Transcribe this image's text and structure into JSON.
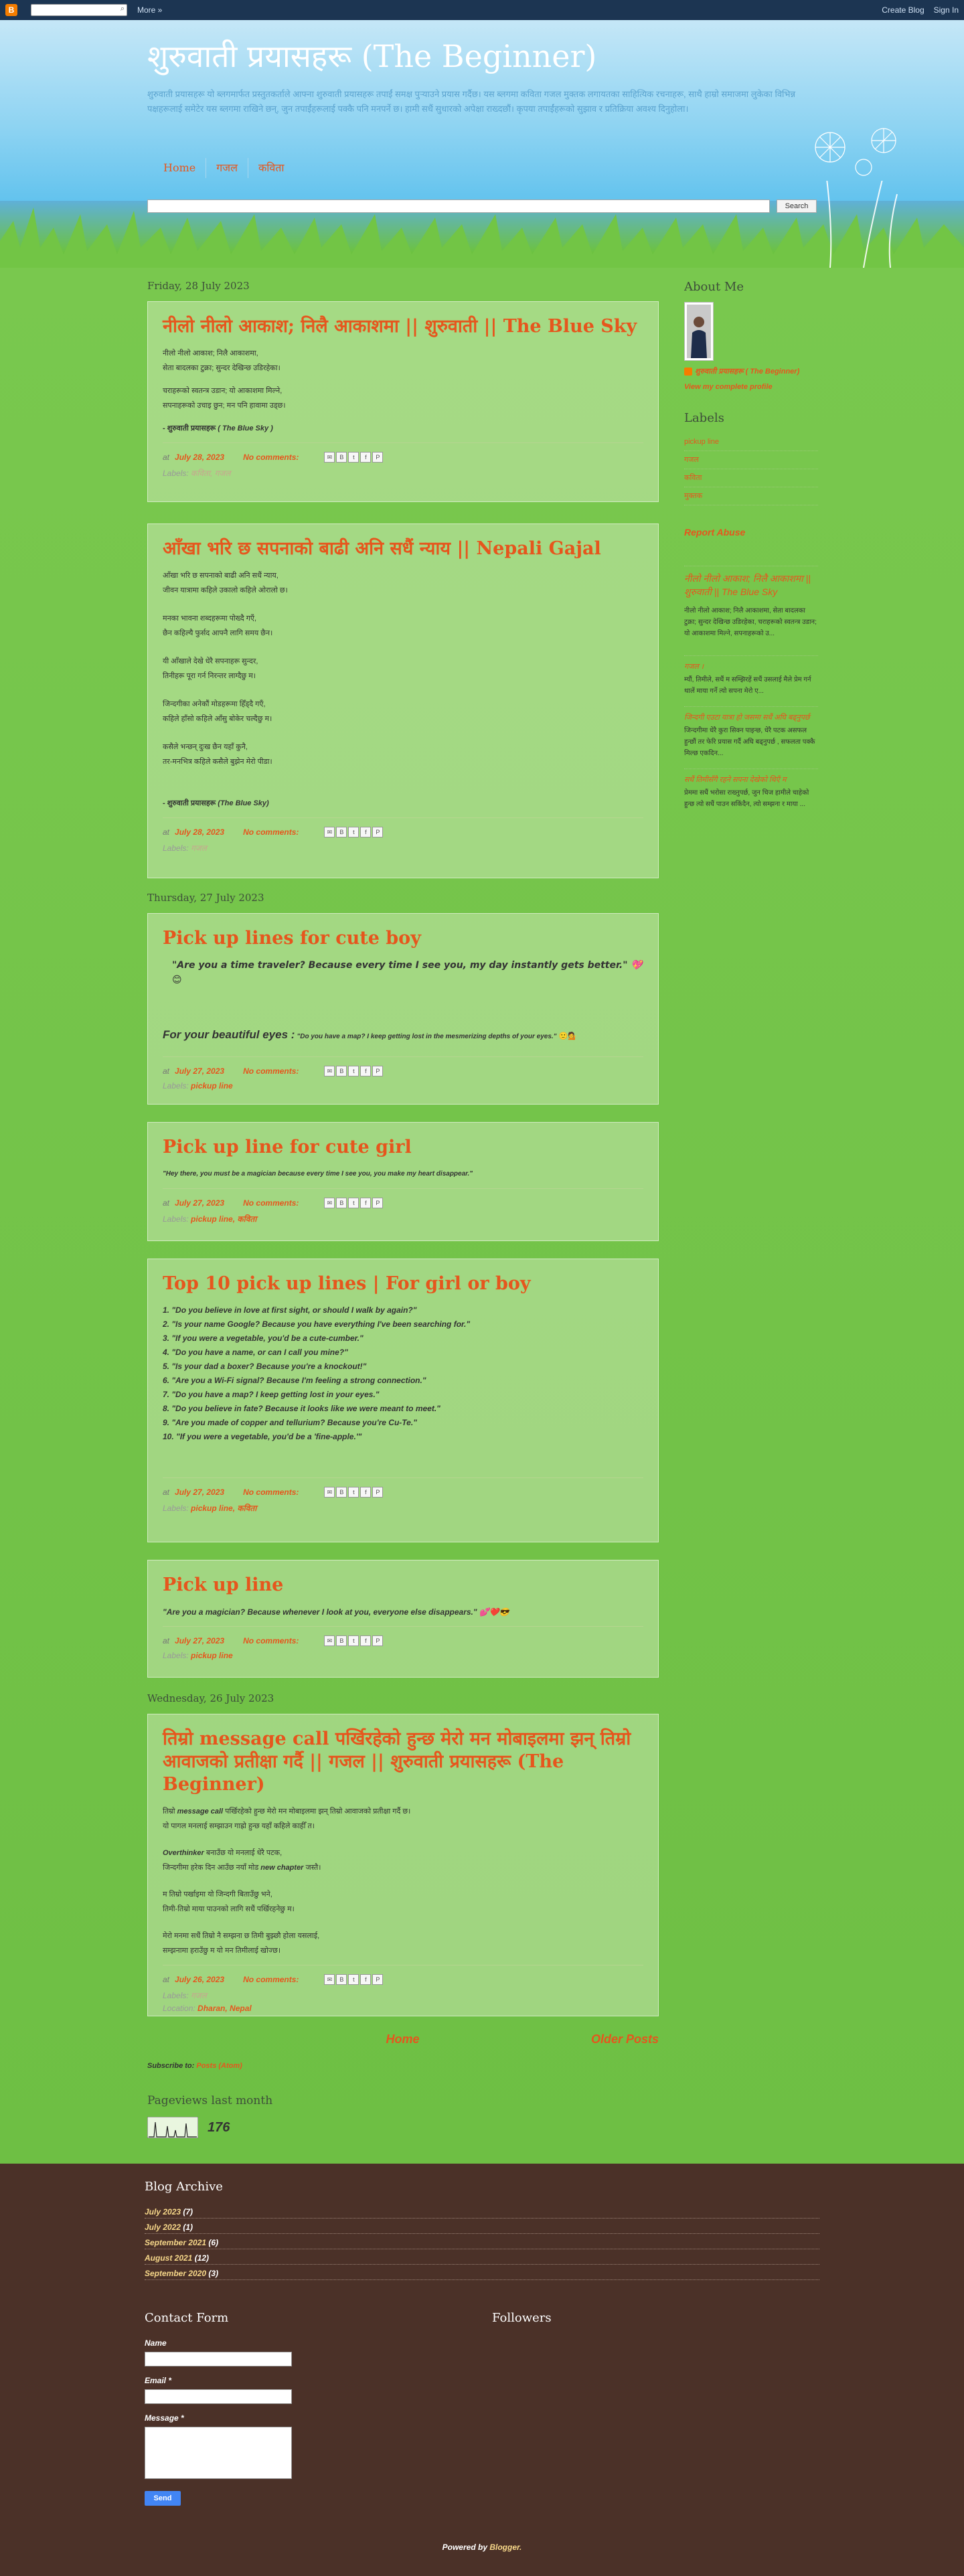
{
  "navbar": {
    "search_icon": "search-icon",
    "more": "More »",
    "create": "Create Blog",
    "signin": "Sign In"
  },
  "header": {
    "title": "शुरुवाती प्रयासहरू (The Beginner)",
    "description": "शुरुवाती प्रयासहरू यो ब्लगमार्फत प्रस्तुतकर्ताले आफ्ना शुरुवाती प्रयासहरू तपाईं समक्ष पुर्‍याउने प्रयास गर्दैछ। यस ब्लगमा कविता गजल मुक्तक लगायतका साहित्यिक रचनाहरू, साथै हाम्रो समाजमा लुकेका विभिन्न पक्षहरूलाई समेटेर यस ब्लगमा राखिने छन्, जुन तपाईंहरूलाई पक्कै पनि मनपर्ने छ। हामी सधैं सुधारको अपेक्षा राख्दछौं। कृपया तपाईंहरूको सुझाव र प्रतिक्रिया अवश्य दिनुहोला।"
  },
  "tabs": [
    "Home",
    "गजल",
    "कविता"
  ],
  "search": {
    "button": "Search"
  },
  "dates": [
    "Friday, 28 July 2023",
    "Thursday, 27 July 2023",
    "Wednesday, 26 July 2023"
  ],
  "posts": [
    {
      "title": "नीलो नीलो आकाश; निलै आकाशमा || शुरुवाती || The Blue Sky",
      "lines": [
        "नीलो नीलो आकाश; निलै आकाशमा,",
        "सेता बादलका टुक्रा; सुन्दर देखिन्छ उडिरहेका।",
        "चराहरूको स्वतन्त्र उडान; यो आकाशमा मिल्ने,",
        "सपनाहरूको उचाइ छुन; मन पनि हावामा उड्छ।"
      ],
      "author": "- शुरुवाती प्रयासहरू",
      "author_em": "( The Blue Sky )",
      "date": "July 28, 2023",
      "comments": "No comments:",
      "labels_prefix": "Labels:",
      "labels": "कविता, गजल"
    },
    {
      "title": "आँखा भरि छ सपनाको बाढी अनि सधैं न्याय || Nepali Gajal",
      "lines": [
        "आँखा भरि छ सपनाको बाढी अनि सधैं न्याय,",
        "जीवन यात्रामा कहिले उकालो कहिले ओरालो छ।",
        "मनका भावना शब्दहरूमा पोख्दै गएँ,",
        "छैन कहिल्यै फुर्सद आफ्नै लागि समय छैन।",
        "यी आँखाले देखे धेरै सपनाहरू सुन्दर,",
        "तिनीहरू पूरा गर्न निरन्तर लाग्दैछु म।",
        "जिन्दगीका अनेकौं मोडहरूमा हिँड्दै गएँ,",
        "कहिले हाँसो कहिले आँसु बोकेर चल्दैछु म।",
        "कसैले भन्छन् दुःख छैन यहाँ कुनै,",
        "तर-मनभित्र कहिले कसैले बुझेन मेरो पीडा।"
      ],
      "author": "- शुरुवाती प्रयासहरू",
      "author_em": "(The Blue Sky)",
      "date": "July 28, 2023",
      "comments": "No comments:",
      "labels_prefix": "Labels:",
      "labels": "गजल"
    },
    {
      "title": "Pick up lines for cute boy",
      "line1": "\"Are you a time traveler? Because every time I see you, my day instantly gets better.\"",
      "emoji1": "💖😊",
      "line2_head": "For your beautiful eyes :",
      "line2": "\"Do you have a map? I keep getting lost in the mesmerizing depths of your eyes.\"",
      "emoji2": "🙂💁",
      "date": "July 27, 2023",
      "comments": "No comments:",
      "labels_prefix": "Labels:",
      "labels": "pickup line"
    },
    {
      "title": "Pick up line for cute girl",
      "line1": "\"Hey there, you must be a magician because every time I see you, you make my heart disappear.\"",
      "date": "July 27, 2023",
      "comments": "No comments:",
      "labels_prefix": "Labels:",
      "labels": "pickup line, कविता"
    },
    {
      "title": "Top 10 pick up lines | For girl or boy",
      "items": [
        "1. \"Do you believe in love at first sight, or should I walk by again?\"",
        "2. \"Is your name Google? Because you have everything I've been searching for.\"",
        "3. \"If you were a vegetable, you'd be a cute-cumber.\"",
        "4. \"Do you have a name, or can I call you mine?\"",
        "5. \"Is your dad a boxer? Because you're a knockout!\"",
        "6. \"Are you a Wi-Fi signal? Because I'm feeling a strong connection.\"",
        "7. \"Do you have a map? I keep getting lost in your eyes.\"",
        "8. \"Do you believe in fate? Because it looks like we were meant to meet.\"",
        "9. \"Are you made of copper and tellurium? Because you're Cu-Te.\"",
        "10. \"If you were a vegetable, you'd be a 'fine-apple.'\""
      ],
      "date": "July 27, 2023",
      "comments": "No comments:",
      "labels_prefix": "Labels:",
      "labels": "pickup line, कविता"
    },
    {
      "title": "Pick up line",
      "line1": "\"Are you a magician? Because whenever I look at you, everyone else disappears.\"",
      "emoji1": "💕❤️😎",
      "date": "July 27, 2023",
      "comments": "No comments:",
      "labels_prefix": "Labels:",
      "labels": "pickup line"
    },
    {
      "title": "तिम्रो message call पर्खिरहेको हुन्छ मेरो मन मोबाइलमा झन् तिम्रो आवाजको प्रतीक्षा गर्दै || गजल || शुरुवाती प्रयासहरू (The Beginner)",
      "l1a": "तिम्रो",
      "l1b": "message call",
      "l1c": "पर्खिरहेको हुन्छ मेरो मन मोबाइलमा झन् तिम्रो आवाजको प्रतीक्षा गर्दै छ।",
      "l2": "यो पागल मनलाई सम्झाउन गाह्रो हुन्छ यहाँ कहिले काहीँ त।",
      "l3a": "Overthinker",
      "l3b": "बनाउँछ यो मनलाई धेरै पटक,",
      "l4a": "जिन्दगीमा हरेक दिन आउँछ नयाँ मोड",
      "l4b": "new chapter",
      "l4c": "जस्तै।",
      "l5": "म तिम्रो पर्खाइमा यो जिन्दगी बिताउँछु भने,",
      "l6": "तिमी-तिम्रो माया पाउनको लागि सधैं पर्खिरहनेछु म।",
      "l7": "मेरो मनमा सधैं तिम्रो नै सम्झना छ तिमी बुझ्छौ होला यसलाई,",
      "l8": "सम्झनामा हराउँछु म यो मन तिमीलाई खोज्छ।",
      "date": "July 26, 2023",
      "comments": "No comments:",
      "labels_prefix": "Labels:",
      "labels": "गजल",
      "location_prefix": "Location:",
      "location": "Dharan, Nepal"
    }
  ],
  "sidebar": {
    "about_title": "About Me",
    "author": "शुरुवाती प्रयासहरू ( The Beginner)",
    "profile": "View my complete profile",
    "labels_title": "Labels",
    "labels": [
      "pickup line",
      "गजल",
      "कविता",
      "मुक्तक"
    ],
    "report": "Report Abuse",
    "recent_title": "नीलो नीलो आकाश; निलै आकाशमा || शुरुवाती || The Blue Sky",
    "recent_snip": "नीलो नीलो आकाश; निलै आकाशमा, सेता बादलका टुक्रा; सुन्दर देखिन्छ उडिरहेका, चराहरूको स्वतन्त्र उडान; यो आकाशमा मिल्ने, सपनाहरूको उ...",
    "p2_title": "गजल ।",
    "p2_snip": "म्यौं, तिमीले, सधैं म सम्झिरहें सधैं उसलाई मैले प्रेम गर्न थालें माया गर्ने त्यो सपना मेरो ए...",
    "p3_title": "जिन्दगी एउटा यात्रा हो जसमा सधैं अघि बढ्नुपर्छ",
    "p3_snip": "जिन्दगीमा धेरै कुरा सिक्न पाइन्छ, धेरै पटक असफल हुन्छौं तर फेरि प्रयास गर्दै अघि बढ्नुपर्छ , सफलता पक्कै मिल्छ एकदिन...",
    "p4_title": "सधैं तिमीसँगै रहने सपना देखेको थिएँ म",
    "p4_snip": "प्रेममा सधैं भरोसा राख्नुपर्छ, जुन चिज हामीले चाहेको हुन्छ त्यो सधैं पाउन सकिंदैन, त्यो सम्झना र माया ..."
  },
  "nav": {
    "home": "Home",
    "older": "Older Posts",
    "subscribe": "Subscribe to:",
    "subscribe_link": "Posts (Atom)"
  },
  "pageviews": {
    "title": "Pageviews last month",
    "count": "176"
  },
  "archive": {
    "title": "Blog Archive",
    "items": [
      {
        "m": "July 2023",
        "c": "(7)"
      },
      {
        "m": "July 2022",
        "c": "(1)"
      },
      {
        "m": "September 2021",
        "c": "(6)"
      },
      {
        "m": "August 2021",
        "c": "(12)"
      },
      {
        "m": "September 2020",
        "c": "(3)"
      }
    ]
  },
  "contact": {
    "title": "Contact Form",
    "name": "Name",
    "email": "Email *",
    "message": "Message *",
    "send": "Send"
  },
  "followers": {
    "title": "Followers"
  },
  "footer": {
    "powered": "Powered by",
    "blogger": "Blogger."
  }
}
